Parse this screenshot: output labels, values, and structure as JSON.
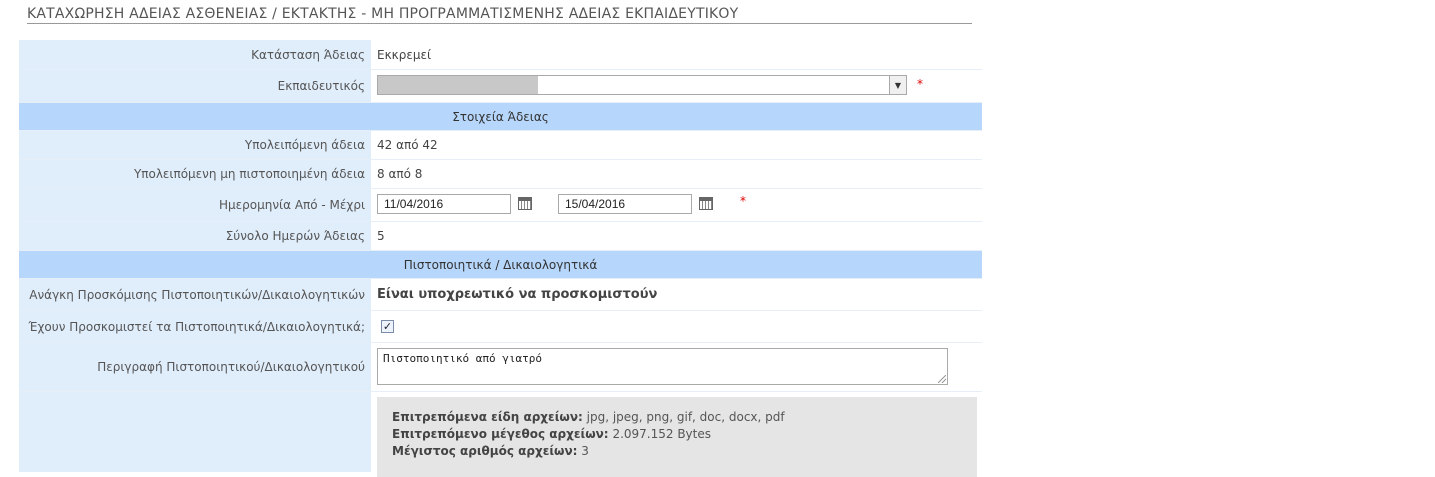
{
  "page": {
    "title": "ΚΑΤΑΧΩΡΗΣΗ ΑΔΕΙΑΣ ΑΣΘΕΝΕΙΑΣ / ΕΚΤΑΚΤΗΣ - ΜΗ ΠΡΟΓΡΑΜΜΑΤΙΣΜΕΝΗΣ ΑΔΕΙΑΣ ΕΚΠΑΙΔΕΥΤΙΚΟΥ"
  },
  "form": {
    "status": {
      "label": "Κατάσταση Άδειας",
      "value": "Εκκρεμεί"
    },
    "teacher": {
      "label": "Εκπαιδευτικός",
      "required_mark": "*"
    },
    "section_leave": "Στοιχεία Άδειας",
    "remaining": {
      "label": "Υπολειπόμενη άδεια",
      "value": "42 από 42"
    },
    "remaining_uncertified": {
      "label": "Υπολειπόμενη μη πιστοποιημένη άδεια",
      "value": "8 από 8"
    },
    "dates": {
      "label": "Ημερομηνία Από - Μέχρι",
      "from": "11/04/2016",
      "to": "15/04/2016",
      "required_mark": "*"
    },
    "total_days": {
      "label": "Σύνολο Ημερών Άδειας",
      "value": "5"
    },
    "section_certs": "Πιστοποιητικά / Δικαιολογητικά",
    "need_certs": {
      "label": "Ανάγκη Προσκόμισης Πιστοποιητικών/Δικαιολογητικών",
      "value": "Είναι υποχρεωτικό να προσκομιστούν"
    },
    "certs_submitted": {
      "label": "Έχουν Προσκομιστεί τα Πιστοποιητικά/Δικαιολογητικά;",
      "checked": true
    },
    "cert_description": {
      "label": "Περιγραφή Πιστοποιητικού/Δικαιολογητικού",
      "value": "Πιστοποιητικό από γιατρό"
    },
    "upload": {
      "types_label": "Επιτρεπόμενα είδη αρχείων:",
      "types_value": "jpg, jpeg, png, gif, doc, docx, pdf",
      "size_label": "Επιτρεπόμενο μέγεθος αρχείων:",
      "size_value": "2.097.152 Bytes",
      "max_label": "Μέγιστος αριθμός αρχείων:",
      "max_value": "3"
    }
  }
}
